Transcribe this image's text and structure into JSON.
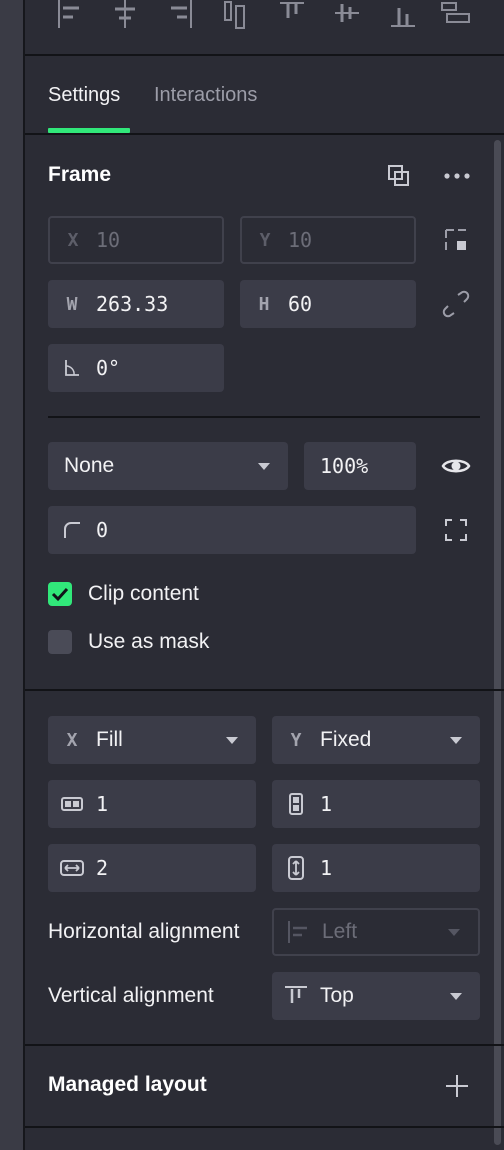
{
  "tabs": [
    {
      "label": "Settings",
      "active": true
    },
    {
      "label": "Interactions",
      "active": false
    }
  ],
  "frame": {
    "title": "Frame",
    "x": {
      "label": "X",
      "value": "10"
    },
    "y": {
      "label": "Y",
      "value": "10"
    },
    "w": {
      "label": "W",
      "value": "263.33"
    },
    "h": {
      "label": "H",
      "value": "60"
    },
    "rotation": "0°"
  },
  "appearance": {
    "blend_mode": "None",
    "opacity": "100%",
    "radius": "0",
    "clip_content": {
      "label": "Clip content",
      "checked": true
    },
    "use_as_mask": {
      "label": "Use as mask",
      "checked": false
    }
  },
  "sizing": {
    "x": {
      "label": "X",
      "value": "Fill"
    },
    "y": {
      "label": "Y",
      "value": "Fixed"
    },
    "column_span": "1",
    "row_span": "1",
    "horizontal_gap": "2",
    "vertical_gap": "1",
    "horizontal_alignment": {
      "label": "Horizontal alignment",
      "value": "Left"
    },
    "vertical_alignment": {
      "label": "Vertical alignment",
      "value": "Top"
    }
  },
  "managed_layout": {
    "title": "Managed layout"
  },
  "colors": {
    "accent": "#31e87a",
    "field_bg": "#3b3c48",
    "panel_bg": "#2b2c35"
  }
}
